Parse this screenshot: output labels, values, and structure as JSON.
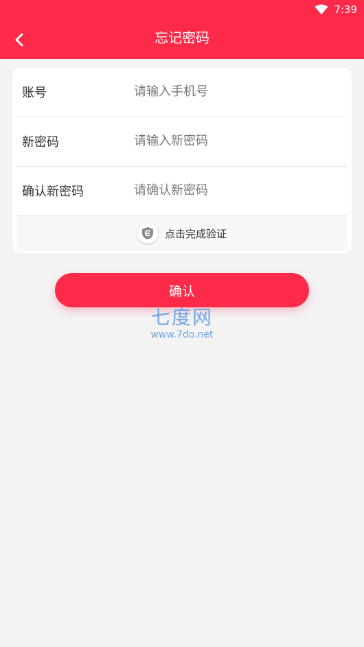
{
  "status_bar": {
    "time": "7:39",
    "wifi_icon": "wifi-icon"
  },
  "header": {
    "title": "忘记密码",
    "back_icon": "chevron-left-icon",
    "color": "#fd2b49"
  },
  "form": {
    "account": {
      "label": "账号",
      "placeholder": "请输入手机号",
      "value": ""
    },
    "new_password": {
      "label": "新密码",
      "placeholder": "请输入新密码",
      "value": ""
    },
    "confirm_password": {
      "label": "确认新密码",
      "placeholder": "请确认新密码",
      "value": ""
    },
    "verify": {
      "text": "点击完成验证",
      "icon": "shield-icon"
    }
  },
  "confirm_button": {
    "label": "确认"
  },
  "watermark": {
    "text": "七度网",
    "url": "www.7do.net"
  }
}
